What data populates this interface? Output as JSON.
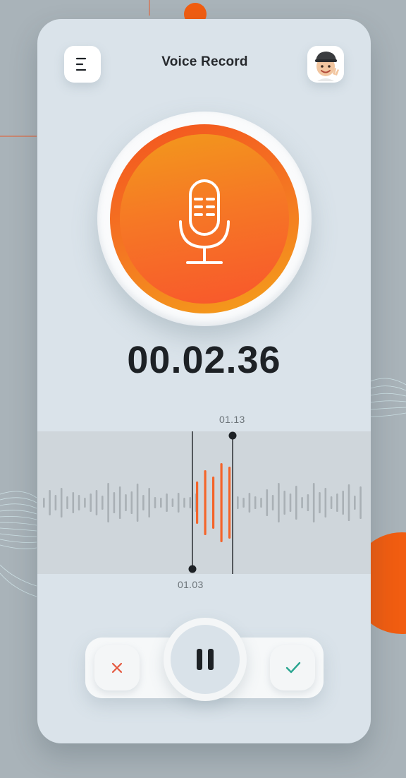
{
  "header": {
    "title": "Voice Record"
  },
  "icons": {
    "menu": "menu-icon",
    "avatar": "avatar-icon",
    "microphone": "microphone-icon",
    "cancel": "close-icon",
    "pause": "pause-icon",
    "confirm": "check-icon"
  },
  "recording": {
    "elapsed": "00.02.36"
  },
  "waveform": {
    "selection_end_label": "01.13",
    "selection_start_label": "01.03"
  },
  "colors": {
    "accent": "#f4642a",
    "accent_light": "#f3a01c",
    "bar_inactive": "#a9b0b5",
    "cancel": "#e4573d",
    "confirm": "#2aa590",
    "dark": "#1d2125"
  }
}
